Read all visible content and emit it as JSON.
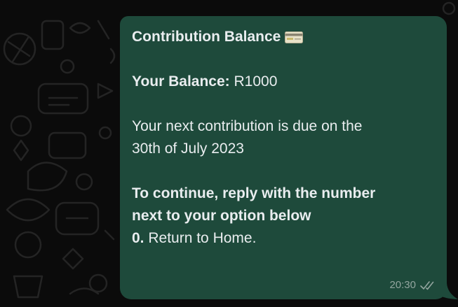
{
  "message": {
    "title": "Contribution Balance",
    "title_icon": "credit-card-icon",
    "balance_label": "Your Balance:",
    "balance_value": "R1000",
    "due_line_1": "Your next contribution is due on the",
    "due_line_2": "30th of July 2023",
    "prompt_line_1": "To continue, reply with the number",
    "prompt_line_2": "next to your option below",
    "option_number": "0.",
    "option_label": "Return to Home.",
    "time": "20:30",
    "status_icon": "double-check-icon"
  },
  "colors": {
    "background": "#0b0b0b",
    "bubble": "#1e4a3b",
    "text": "#e9edef",
    "meta": "#93a59f"
  }
}
